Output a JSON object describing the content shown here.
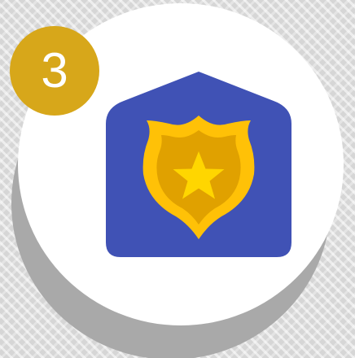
{
  "step_badge": {
    "number": "3",
    "color": "#D7A71A"
  },
  "icon": {
    "name": "police-station-shield-icon",
    "house_color": "#4052B5",
    "shield_outer_color": "#FFC107",
    "shield_inner_color": "#E0A100",
    "star_color": "#FFD600"
  },
  "colors": {
    "background": "#D6D6D6",
    "disc": "#FFFFFF",
    "disc_shadow": "#A9A9A9"
  }
}
